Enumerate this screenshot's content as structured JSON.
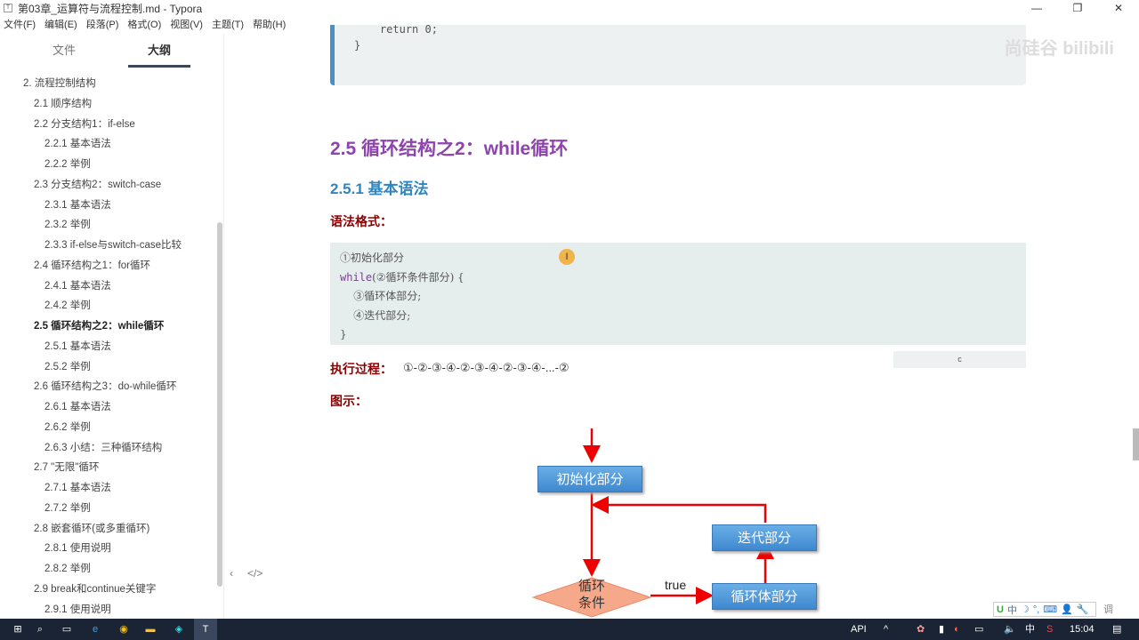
{
  "window": {
    "title": "第03章_运算符与流程控制.md - Typora",
    "controls": [
      "—",
      "❐",
      "✕"
    ]
  },
  "menu": [
    "文件(F)",
    "编辑(E)",
    "段落(P)",
    "格式(O)",
    "视图(V)",
    "主题(T)",
    "帮助(H)"
  ],
  "sidebar": {
    "tabs": [
      "文件",
      "大纲"
    ],
    "active_tab": "大纲",
    "outline": [
      {
        "label": "2. 流程控制结构",
        "level": 1
      },
      {
        "label": "2.1 顺序结构",
        "level": 2
      },
      {
        "label": "2.2 分支结构1：if-else",
        "level": 2
      },
      {
        "label": "2.2.1 基本语法",
        "level": 3
      },
      {
        "label": "2.2.2 举例",
        "level": 3
      },
      {
        "label": "2.3 分支结构2：switch-case",
        "level": 2
      },
      {
        "label": "2.3.1 基本语法",
        "level": 3
      },
      {
        "label": "2.3.2 举例",
        "level": 3
      },
      {
        "label": "2.3.3 if-else与switch-case比较",
        "level": 3
      },
      {
        "label": "2.4 循环结构之1：for循环",
        "level": 2
      },
      {
        "label": "2.4.1 基本语法",
        "level": 3
      },
      {
        "label": "2.4.2 举例",
        "level": 3
      },
      {
        "label": "2.5 循环结构之2：while循环",
        "level": 2,
        "current": true
      },
      {
        "label": "2.5.1 基本语法",
        "level": 3
      },
      {
        "label": "2.5.2 举例",
        "level": 3
      },
      {
        "label": "2.6 循环结构之3：do-while循环",
        "level": 2
      },
      {
        "label": "2.6.1 基本语法",
        "level": 3
      },
      {
        "label": "2.6.2 举例",
        "level": 3
      },
      {
        "label": "2.6.3 小结：三种循环结构",
        "level": 3
      },
      {
        "label": "2.7 \"无限\"循环",
        "level": 2
      },
      {
        "label": "2.7.1 基本语法",
        "level": 3
      },
      {
        "label": "2.7.2 举例",
        "level": 3
      },
      {
        "label": "2.8 嵌套循环(或多重循环)",
        "level": 2
      },
      {
        "label": "2.8.1 使用说明",
        "level": 3
      },
      {
        "label": "2.8.2 举例",
        "level": 3
      },
      {
        "label": "2.9 break和continue关键字",
        "level": 2
      },
      {
        "label": "2.9.1 使用说明",
        "level": 3
      }
    ],
    "footer": [
      "‹",
      "</>"
    ]
  },
  "content": {
    "top_code": [
      "    return 0;",
      "}"
    ],
    "watermark": "尚硅谷 bilibili",
    "h2": "2.5 循环结构之2：while循环",
    "h3": "2.5.1 基本语法",
    "syntax_label": "语法格式：",
    "code": {
      "kw": "while",
      "lines": [
        "①初始化部分",
        "(②循环条件部分) {",
        "    ③循环体部分;",
        "    ④迭代部分;",
        "}"
      ]
    },
    "small_box": "c",
    "process_label": "执行过程：",
    "process": "①-②-③-④-②-③-④-②-③-④-...-②",
    "diagram_label": "图示：",
    "flow": {
      "init": "初始化部分",
      "cond": [
        "循环",
        "条件"
      ],
      "body": "循环体部分",
      "iter": "迭代部分",
      "true": "true"
    }
  },
  "ime": {
    "items": [
      "中",
      "☽",
      "°,",
      "⌨",
      "👤",
      "🔧"
    ],
    "extra": "调"
  },
  "taskbar": {
    "api": "API",
    "lang": "中",
    "time": "15:04"
  }
}
